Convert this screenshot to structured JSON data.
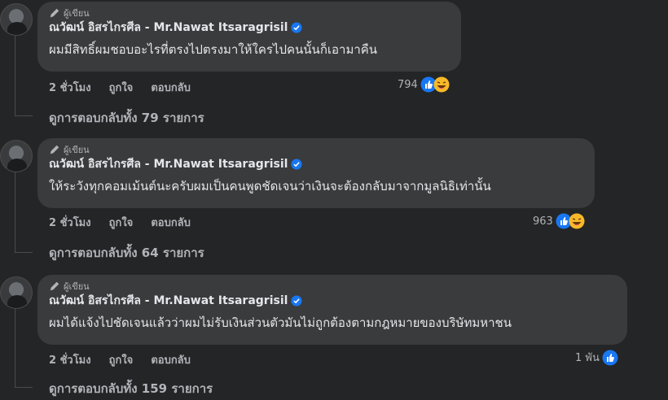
{
  "comments": [
    {
      "badge": "ผู้เขียน",
      "author": "ณวัฒน์ อิสรไกรศีล - Mr.Nawat Itsaragrisil",
      "text": "ผมมีสิทธิ์ผมชอบอะไรที่ตรงไปตรงมาให้ใครไปคนนั้นก็เอามาคืน",
      "time": "2 ชั่วโมง",
      "like": "ถูกใจ",
      "reply": "ตอบกลับ",
      "reaction_count": "794",
      "reactions": [
        "like-icon",
        "laugh-icon"
      ],
      "view_replies": "ดูการตอบกลับทั้ง 79 รายการ"
    },
    {
      "badge": "ผู้เขียน",
      "author": "ณวัฒน์ อิสรไกรศีล - Mr.Nawat Itsaragrisil",
      "text": "ให้ระวังทุกคอมเม้นต์นะครับผมเป็นคนพูดชัดเจนว่าเงินจะต้องกลับมาจากมูลนิธิเท่านั้น",
      "time": "2 ชั่วโมง",
      "like": "ถูกใจ",
      "reply": "ตอบกลับ",
      "reaction_count": "963",
      "reactions": [
        "like-icon",
        "laugh-icon"
      ],
      "view_replies": "ดูการตอบกลับทั้ง 64 รายการ"
    },
    {
      "badge": "ผู้เขียน",
      "author": "ณวัฒน์ อิสรไกรศีล - Mr.Nawat Itsaragrisil",
      "text": "ผมได้แจ้งไปชัดเจนแล้วว่าผมไม่รับเงินส่วนตัวมันไม่ถูกต้องตามกฎหมายของบริษัทมหาชน",
      "time": "2 ชั่วโมง",
      "like": "ถูกใจ",
      "reply": "ตอบกลับ",
      "reaction_count": "1 พัน",
      "reactions": [
        "like-icon"
      ],
      "view_replies": "ดูการตอบกลับทั้ง 159 รายการ"
    }
  ],
  "colors": {
    "background": "#242526",
    "bubble": "#3a3b3c",
    "text": "#e4e6eb",
    "muted": "#b0b3b8",
    "verified": "#1877f2"
  }
}
